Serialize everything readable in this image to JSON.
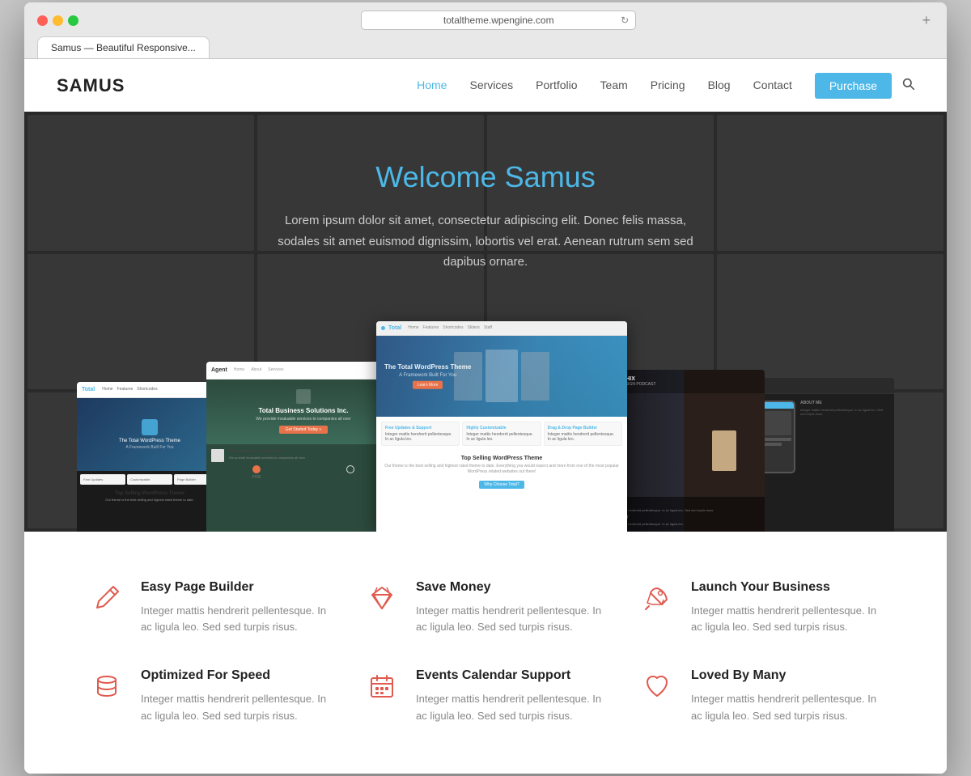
{
  "browser": {
    "url": "totaltheme.wpengine.com",
    "tab_label": "Samus — Beautiful Responsive..."
  },
  "nav": {
    "logo": "SAMUS",
    "links": [
      {
        "label": "Home",
        "active": true
      },
      {
        "label": "Services",
        "active": false
      },
      {
        "label": "Portfolio",
        "active": false
      },
      {
        "label": "Team",
        "active": false
      },
      {
        "label": "Pricing",
        "active": false
      },
      {
        "label": "Blog",
        "active": false
      },
      {
        "label": "Contact",
        "active": false
      }
    ],
    "purchase_label": "Purchase"
  },
  "hero": {
    "title": "Welcome Samus",
    "description": "Lorem ipsum dolor sit amet, consectetur adipiscing elit. Donec felis massa, sodales sit amet euismod dignissim, lobortis vel erat. Aenean rutrum sem sed dapibus ornare."
  },
  "screenshots": {
    "main": {
      "nav_text": "Total",
      "hero_line1": "The Total WordPress Theme",
      "hero_line2": "A Framework Built For You",
      "feature1_title": "Free Updates & Support",
      "feature2_title": "Highly Customizable",
      "feature3_title": "Drag & Drop Page Builder",
      "bottom_title": "Top Selling WordPress Theme",
      "bottom_text": "Our theme is the best selling and highest rated theme to date. Everything you would expect and more from one of the most popular WordPress related websites out there!"
    },
    "left": {
      "logo": "Agent",
      "hero_title": "Total Business Solutions Inc.",
      "hero_sub": "We provide invaluable services to companies all over",
      "btn_label": "Get Started Today »"
    },
    "right": {
      "title": "GRAPHIX",
      "sub": "WEB DESIGN PODCAST"
    }
  },
  "features": [
    {
      "id": "easy-page-builder",
      "icon": "pencil",
      "title": "Easy Page Builder",
      "description": "Integer mattis hendrerit pellentesque. In ac ligula leo. Sed sed turpis risus."
    },
    {
      "id": "save-money",
      "icon": "diamond",
      "title": "Save Money",
      "description": "Integer mattis hendrerit pellentesque. In ac ligula leo. Sed sed turpis risus."
    },
    {
      "id": "launch-your-business",
      "icon": "rocket",
      "title": "Launch Your Business",
      "description": "Integer mattis hendrerit pellentesque. In ac ligula leo. Sed sed turpis risus."
    },
    {
      "id": "optimized-for-speed",
      "icon": "database",
      "title": "Optimized For Speed",
      "description": "Integer mattis hendrerit pellentesque. In ac ligula leo. Sed sed turpis risus."
    },
    {
      "id": "events-calendar",
      "icon": "calendar",
      "title": "Events Calendar Support",
      "description": "Integer mattis hendrerit pellentesque. In ac ligula leo. Sed sed turpis risus."
    },
    {
      "id": "loved-by-many",
      "icon": "heart",
      "title": "Loved By Many",
      "description": "Integer mattis hendrerit pellentesque. In ac ligula leo. Sed sed turpis risus."
    }
  ],
  "colors": {
    "accent": "#4db8e8",
    "icon_red": "#e05a4e",
    "purchase_bg": "#4db8e8"
  }
}
